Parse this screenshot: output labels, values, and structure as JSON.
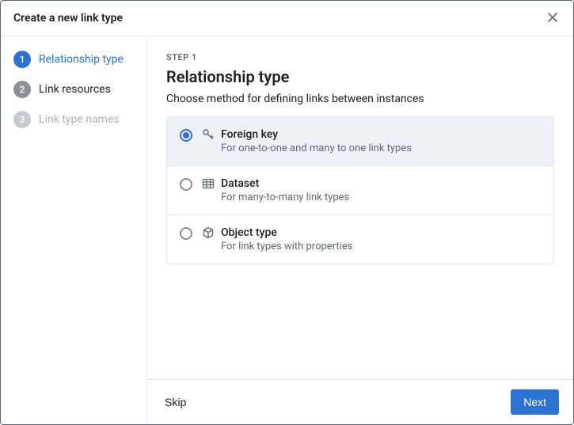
{
  "dialog": {
    "title": "Create a new link type"
  },
  "sidebar": {
    "steps": [
      {
        "num": "1",
        "label": "Relationship type",
        "state": "active"
      },
      {
        "num": "2",
        "label": "Link resources",
        "state": "pending"
      },
      {
        "num": "3",
        "label": "Link type names",
        "state": "disabled"
      }
    ]
  },
  "main": {
    "eyebrow": "STEP 1",
    "heading": "Relationship type",
    "description": "Choose method for defining links between instances",
    "options": [
      {
        "icon": "key-icon",
        "title": "Foreign key",
        "subtitle": "For one-to-one and many to one link types",
        "selected": true
      },
      {
        "icon": "dataset-icon",
        "title": "Dataset",
        "subtitle": "For many-to-many link types",
        "selected": false
      },
      {
        "icon": "object-type-icon",
        "title": "Object type",
        "subtitle": "For link types with properties",
        "selected": false
      }
    ]
  },
  "footer": {
    "skip": "Skip",
    "next": "Next"
  },
  "colors": {
    "primary": "#2d72d2",
    "muted": "#5e6875"
  }
}
